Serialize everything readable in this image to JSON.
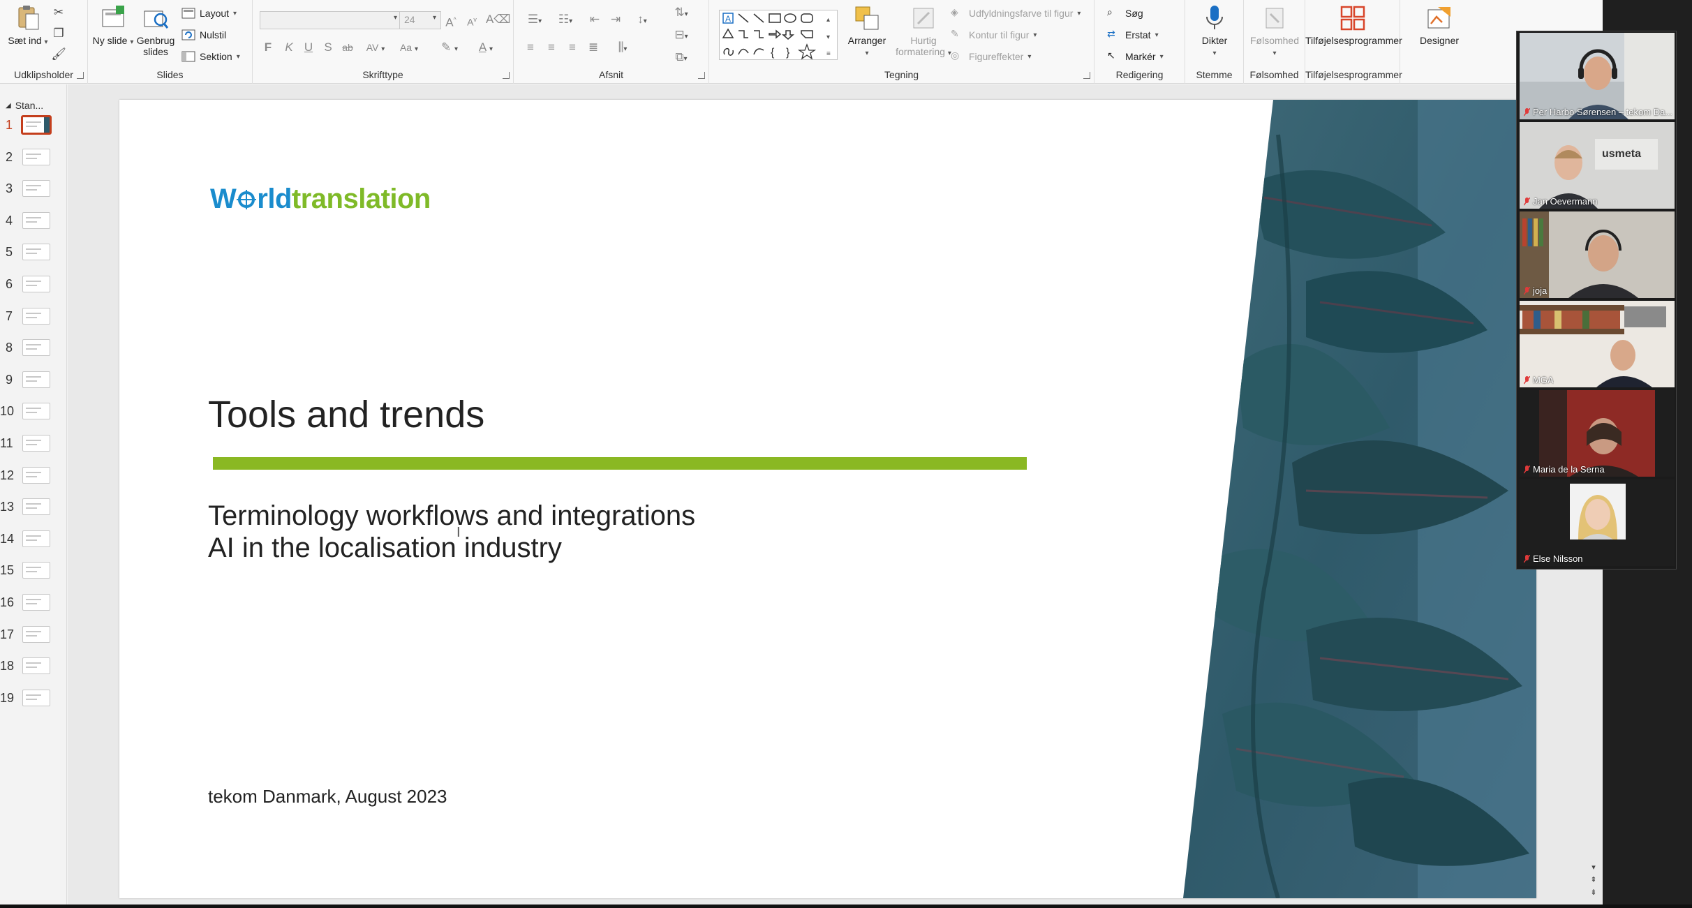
{
  "ribbon": {
    "clipboard": {
      "paste_label": "Sæt ind",
      "group_label": "Udklipsholder"
    },
    "slides": {
      "new_slide_label": "Ny slide",
      "reuse_label": "Genbrug slides",
      "layout_label": "Layout",
      "reset_label": "Nulstil",
      "section_label": "Sektion",
      "group_label": "Slides"
    },
    "font": {
      "font_size": "24",
      "group_label": "Skrifttype",
      "bold": "F",
      "italic": "K",
      "underline": "U",
      "shadow": "S",
      "strike": "ab",
      "spacing": "AV",
      "case": "Aa"
    },
    "paragraph": {
      "group_label": "Afsnit"
    },
    "drawing": {
      "arrange_label": "Arranger",
      "quick_label": "Hurtig formatering",
      "fill_label": "Udfyldningsfarve til figur",
      "outline_label": "Kontur til figur",
      "effects_label": "Figureffekter",
      "group_label": "Tegning"
    },
    "editing": {
      "search_label": "Søg",
      "replace_label": "Erstat",
      "select_label": "Markér",
      "group_label": "Redigering"
    },
    "voice": {
      "dictate_label": "Dikter",
      "group_label": "Stemme"
    },
    "sensitivity": {
      "label": "Følsomhed",
      "group_label": "Følsomhed"
    },
    "addins": {
      "label": "Tilføjelsesprogrammer",
      "group_label": "Tilføjelsesprogrammer"
    },
    "designer": {
      "label": "Designer"
    }
  },
  "thumbnails": {
    "section_name": "Stan...",
    "slides": [
      "1",
      "2",
      "3",
      "4",
      "5",
      "6",
      "7",
      "8",
      "9",
      "10",
      "11",
      "12",
      "13",
      "14",
      "15",
      "16",
      "17",
      "18",
      "19"
    ],
    "active_index": 0
  },
  "slide": {
    "logo_part1": "W",
    "logo_part2": "rld",
    "logo_part3": "translation",
    "title": "Tools and trends",
    "subtitle_line1": "Terminology workflows and integrations",
    "subtitle_line2": "AI in the localisation industry",
    "footer": "tekom Danmark, August 2023",
    "colors": {
      "logo_blue": "#1a8ccd",
      "logo_green": "#7fba28",
      "bar_green": "#8ab823"
    }
  },
  "participants": [
    {
      "name": "Per Harbo Sørensen – tekom Da..."
    },
    {
      "name": "Jan Oevermann"
    },
    {
      "name": "joja"
    },
    {
      "name": "MGA"
    },
    {
      "name": "Maria de la Serna"
    },
    {
      "name": "Else Nilsson"
    }
  ],
  "icons": [
    "paste-icon",
    "cut-icon",
    "copy-icon",
    "format-painter-icon",
    "new-slide-icon",
    "reuse-slides-icon",
    "layout-icon",
    "reset-icon",
    "section-icon",
    "shapes-icon",
    "arrange-icon",
    "quick-styles-icon",
    "search-icon",
    "replace-icon",
    "select-icon",
    "microphone-icon",
    "sensitivity-icon",
    "addins-icon",
    "designer-icon",
    "mic-off-icon"
  ]
}
